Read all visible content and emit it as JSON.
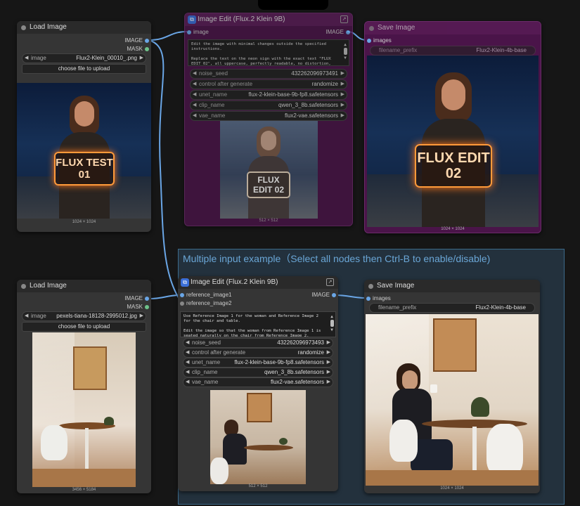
{
  "group": {
    "title": "Multiple input example（Select all nodes then Ctrl-B to enable/disable)"
  },
  "top_row": {
    "load_image": {
      "title": "Load Image",
      "outputs": [
        "IMAGE",
        "MASK"
      ],
      "image_widget": {
        "label": "image",
        "value": "Flux2-Klein_00010_.png"
      },
      "upload_button": "choose file to upload",
      "dimensions": "1024 × 1024",
      "sign_text": "FLUX TEST 01"
    },
    "image_edit": {
      "title": "Image Edit (Flux.2 Klein 9B)",
      "input": "image",
      "output": "IMAGE",
      "prompt": "Edit the image with minimal changes outside the specified instructions.\n\nReplace the text on the neon sign with the exact text \"FLUX EDIT 02\", all uppercase, perfectly readable, no distortion, same sign size and position.",
      "widgets": [
        {
          "label": "noise_seed",
          "value": "432262096973491"
        },
        {
          "label": "control after generate",
          "value": "randomize"
        },
        {
          "label": "unet_name",
          "value": "flux-2-klein-base-9b-fp8.safetensors"
        },
        {
          "label": "clip_name",
          "value": "qwen_3_8b.safetensors"
        },
        {
          "label": "vae_name",
          "value": "flux2-vae.safetensors"
        }
      ],
      "preview_sign": "FLUX EDIT 02",
      "dimensions": "512 × 512"
    },
    "save_image": {
      "title": "Save Image",
      "input": "images",
      "widget": {
        "label": "filename_prefix",
        "value": "Flux2-Klein-4b-base"
      },
      "dimensions": "1024 × 1024",
      "sign_text": "FLUX EDIT 02"
    }
  },
  "bottom_row": {
    "load_image": {
      "title": "Load Image",
      "outputs": [
        "IMAGE",
        "MASK"
      ],
      "image_widget": {
        "label": "image",
        "value": "pexels-tiana-18128-2995012.jpg"
      },
      "upload_button": "choose file to upload",
      "dimensions": "3456 × 5184"
    },
    "image_edit": {
      "title": "Image Edit (Flux.2 Klein 9B)",
      "inputs": [
        "reference_image1",
        "reference_image2"
      ],
      "output": "IMAGE",
      "prompt": "Use Reference Image 1 for the woman and Reference Image 2 for the chair and table.\n\nEdit the image so that the woman from Reference Image 1 is seated naturally on the chair from Reference Image 2.",
      "widgets": [
        {
          "label": "noise_seed",
          "value": "432262096973493"
        },
        {
          "label": "control after generate",
          "value": "randomize"
        },
        {
          "label": "unet_name",
          "value": "flux-2-klein-base-9b-fp8.safetensors"
        },
        {
          "label": "clip_name",
          "value": "qwen_3_8b.safetensors"
        },
        {
          "label": "vae_name",
          "value": "flux2-vae.safetensors"
        }
      ],
      "dimensions": "512 × 512"
    },
    "save_image": {
      "title": "Save Image",
      "input": "images",
      "widget": {
        "label": "filename_prefix",
        "value": "Flux2-Klein-4b-base"
      },
      "dimensions": "1024 × 1024"
    }
  },
  "colors": {
    "canvas": "#161616",
    "node": "#353535",
    "muted_node": "#4a1449",
    "link": "#6aa6e6",
    "group": "#34526c",
    "neon": "#ff9a3a"
  }
}
